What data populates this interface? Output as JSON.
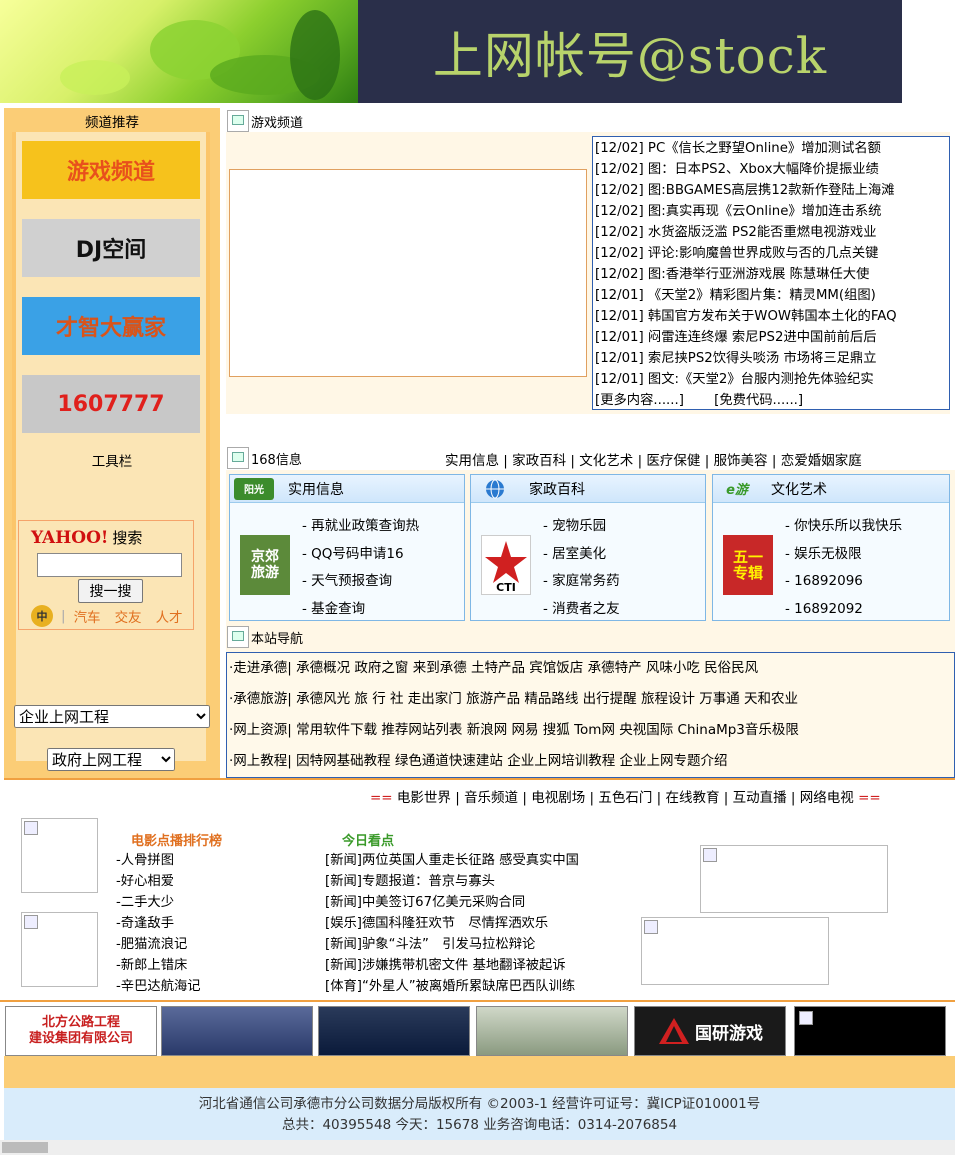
{
  "banner": {
    "title": "上网帐号@stock"
  },
  "sidebar": {
    "channel_title": "频道推荐",
    "channels": [
      {
        "label": "游戏频道",
        "color": "#e8501c",
        "bg": "#f6c21c"
      },
      {
        "label": "DJ空间",
        "color": "#111111",
        "bg": "#d0d0d0"
      },
      {
        "label": "才智大赢家",
        "color": "#d9541a",
        "bg": "#3aa1e6"
      },
      {
        "label": "1607777",
        "color": "#e0201c",
        "bg": "#c8c8c8"
      }
    ],
    "tools_title": "工具栏",
    "yahoo": {
      "logo": "YAHOO!",
      "search_label": "搜索",
      "input_value": "",
      "button": "搜一搜",
      "links": [
        "汽车",
        "交友",
        "人才"
      ]
    },
    "select_enterprise": "企业上网工程",
    "select_government": "政府上网工程"
  },
  "game": {
    "title": "游戏频道",
    "news": [
      "[12/02] PC《信长之野望Online》增加测试名额",
      "[12/02] 图：日本PS2、Xbox大幅降价提振业绩",
      "[12/02] 图:BBGAMES高层携12款新作登陆上海滩",
      "[12/02] 图:真实再现《云Online》增加连击系统",
      "[12/02] 水货盗版泛滥 PS2能否重燃电视游戏业",
      "[12/02] 评论:影响魔兽世界成败与否的几点关键",
      "[12/02] 图:香港举行亚洲游戏展 陈慧琳任大使",
      "[12/01] 《天堂2》精彩图片集：精灵MM(组图)",
      "[12/01] 韩国官方发布关于WOW韩国本土化的FAQ",
      "[12/01] 闷雷连连终爆 索尼PS2进中国前前后后",
      "[12/01] 索尼挟PS2饮得头啖汤 市场将三足鼎立",
      "[12/01] 图文:《天堂2》台服内测抢先体验纪实"
    ],
    "more": "[更多内容......]",
    "free_code": "[免费代码......]"
  },
  "info168": {
    "title": "168信息",
    "nav": [
      "实用信息",
      "家政百科",
      "文化艺术",
      "医疗保健",
      "服饰美容",
      "恋爱婚姻家庭"
    ],
    "cards": [
      {
        "title": "实用信息",
        "logo": "阳光\n旅游",
        "logo_bg": "#3c8c2c",
        "pic": "京郊\n旅游",
        "pic_bg": "#5c8a3a",
        "items": [
          "- 再就业政策查询热",
          "- QQ号码申请16",
          "- 天气预报查询",
          "- 基金查询"
        ]
      },
      {
        "title": "家政百科",
        "logo": "globe",
        "logo_bg": "#2a7ad0",
        "pic": "CTI",
        "pic_bg": "#ffffff",
        "items": [
          "- 宠物乐园",
          "- 居室美化",
          "- 家庭常务药",
          "- 消费者之友"
        ]
      },
      {
        "title": "文化艺术",
        "logo": "e游",
        "logo_bg": "#3a9a2a",
        "pic": "五一\n专辑",
        "pic_bg": "#c82828",
        "items": [
          "- 你快乐所以我快乐",
          "- 娱乐无极限",
          "- 16892096",
          "- 16892092"
        ]
      }
    ]
  },
  "sitenav": {
    "title": "本站导航",
    "rows": [
      "·走进承德| 承德概况 政府之窗 来到承德 土特产品 宾馆饭店 承德特产 风味小吃 民俗民风",
      "·承德旅游| 承德风光 旅 行 社 走出家门 旅游产品 精品路线 出行提醒 旅程设计 万事通 天和农业",
      "·网上资源| 常用软件下载 推荐网站列表 新浪网 网易 搜狐 Tom网 央视国际 ChinaMp3音乐极限",
      "·网上教程| 因特网基础教程 绿色通道快速建站 企业上网培训教程 企业上网专题介绍"
    ]
  },
  "media": {
    "nav_prefix": "==",
    "nav": [
      "电影世界",
      "音乐频道",
      "电视剧场",
      "五色石门",
      "在线教育",
      "互动直播",
      "网络电视"
    ],
    "nav_suffix": "==",
    "movies_title": "电影点播排行榜",
    "movies": [
      "-人骨拼图",
      "-好心相爱",
      "-二手大少",
      "-奇逢敌手",
      "-肥猫流浪记",
      "-新郎上错床",
      "-辛巴达航海记"
    ],
    "today_title": "今日看点",
    "today": [
      "[新闻]两位英国人重走长征路 感受真实中国",
      "[新闻]专题报道：普京与寡头",
      "[新闻]中美签订67亿美元采购合同",
      "[娱乐]德国科隆狂欢节　尽情挥洒欢乐",
      "[新闻]驴象“斗法”　引发马拉松辩论",
      "[新闻]涉嫌携带机密文件 基地翻译被起诉",
      "[体育]“外星人”被离婚所累缺席巴西队训练"
    ]
  },
  "partners": [
    {
      "label": "北方公路工程\n建设集团有限公司",
      "bg": "#ffffff",
      "color": "#c82020"
    },
    {
      "label": "",
      "bg": "#3a4a7a",
      "color": "#ffffff"
    },
    {
      "label": "",
      "bg": "#1a2a4a",
      "color": "#e0c040"
    },
    {
      "label": "",
      "bg": "#a8b0a0",
      "color": "#ffffff"
    },
    {
      "label": "国研游戏",
      "bg": "#1a1a1a",
      "color": "#ffffff"
    },
    {
      "label": "",
      "bg": "#000000",
      "color": "#ffffff"
    }
  ],
  "footer": {
    "line1": "河北省通信公司承德市分公司数据分局版权所有 ©2003-1 经营许可证号：冀ICP证010001号",
    "line2": "总共：40395548 今天：15678 业务咨询电话：0314-2076854"
  }
}
